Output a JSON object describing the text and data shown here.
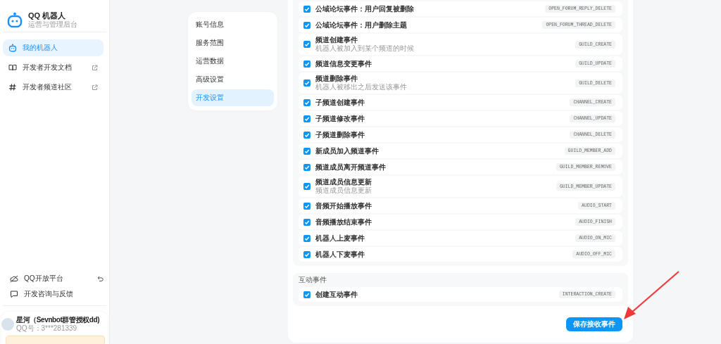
{
  "sidebar": {
    "app_title": "QQ 机器人",
    "app_subtitle": "运营与管理后台",
    "nav": [
      {
        "label": "我的机器人",
        "selected": true,
        "kind": "robot",
        "external": false
      },
      {
        "label": "开发者开发文档",
        "selected": false,
        "kind": "book",
        "external": true
      },
      {
        "label": "开发者频道社区",
        "selected": false,
        "kind": "hash",
        "external": true
      }
    ],
    "footer_links": [
      {
        "label": "QQ开放平台",
        "kind": "platform"
      },
      {
        "label": "开发咨询与反馈",
        "kind": "chat"
      }
    ],
    "user": {
      "name": "星河（Sevnbot群管授权dd)",
      "qq": "QQ号：3***281339"
    }
  },
  "submenu": [
    {
      "label": "账号信息",
      "selected": false
    },
    {
      "label": "服务范围",
      "selected": false
    },
    {
      "label": "运营数据",
      "selected": false
    },
    {
      "label": "高级设置",
      "selected": false
    },
    {
      "label": "开发设置",
      "selected": true
    }
  ],
  "event_groups": [
    {
      "rows": [
        {
          "title": "公域论坛事件：用户回复被删除",
          "code": "OPEN_FORUM_REPLY_DELETE",
          "checked": true
        },
        {
          "title": "公域论坛事件：用户删除主题",
          "code": "OPEN_FORUM_THREAD_DELETE",
          "checked": true
        },
        {
          "title": "频道创建事件",
          "description": "机器人被加入到某个频道的时候",
          "code": "GUILD_CREATE",
          "checked": true
        },
        {
          "title": "频道信息变更事件",
          "code": "GUILD_UPDATE",
          "checked": true
        },
        {
          "title": "频道删除事件",
          "description": "机器人被移出之后发送该事件",
          "code": "GUILD_DELETE",
          "checked": true
        },
        {
          "title": "子频道创建事件",
          "code": "CHANNEL_CREATE",
          "checked": true
        },
        {
          "title": "子频道修改事件",
          "code": "CHANNEL_UPDATE",
          "checked": true
        },
        {
          "title": "子频道删除事件",
          "code": "CHANNEL_DELETE",
          "checked": true
        },
        {
          "title": "新成员加入频道事件",
          "code": "GUILD_MEMBER_ADD",
          "checked": true
        },
        {
          "title": "频道成员离开频道事件",
          "code": "GUILD_MEMBER_REMOVE",
          "checked": true
        },
        {
          "title": "频道成员信息更新",
          "description": "频道成员信息更新",
          "code": "GUILD_MEMBER_UPDATE",
          "checked": true
        },
        {
          "title": "音频开始播放事件",
          "code": "AUDIO_START",
          "checked": true
        },
        {
          "title": "音频播放结束事件",
          "code": "AUDIO_FINISH",
          "checked": true
        },
        {
          "title": "机器人上麦事件",
          "code": "AUDIO_ON_MIC",
          "checked": true
        },
        {
          "title": "机器人下麦事件",
          "code": "AUDIO_OFF_MIC",
          "checked": true
        }
      ]
    },
    {
      "title": "互动事件",
      "rows": [
        {
          "title": "创建互动事件",
          "code": "INTERACTION_CREATE",
          "checked": true
        }
      ]
    }
  ],
  "save_button": "保存接收事件"
}
